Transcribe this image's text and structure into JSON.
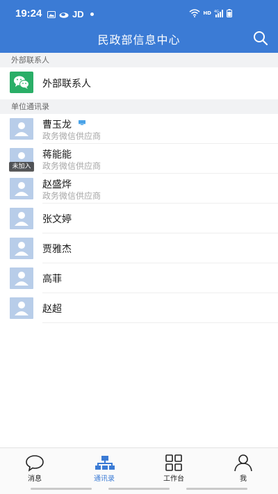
{
  "status_bar": {
    "time": "19:24",
    "jd": "JD",
    "hd": "HD",
    "net": "4G"
  },
  "header": {
    "title": "民政部信息中心"
  },
  "sections": {
    "external": "外部联系人",
    "directory": "单位通讯录"
  },
  "external_contact": {
    "label": "外部联系人"
  },
  "contacts": [
    {
      "name": "曹玉龙",
      "subtitle": "政务微信供应商"
    },
    {
      "name": "蒋能能",
      "subtitle": "政务微信供应商",
      "badge": "未加入"
    },
    {
      "name": "赵盛烨",
      "subtitle": "政务微信供应商"
    },
    {
      "name": "张文婷"
    },
    {
      "name": "贾雅杰"
    },
    {
      "name": "高菲"
    },
    {
      "name": "赵超"
    }
  ],
  "tabs": [
    {
      "label": "消息",
      "icon": "chat-bubble-icon"
    },
    {
      "label": "通讯录",
      "icon": "org-chart-icon",
      "active": true
    },
    {
      "label": "工作台",
      "icon": "grid-icon"
    },
    {
      "label": "我",
      "icon": "person-icon"
    }
  ],
  "colors": {
    "accent": "#3b7bd5",
    "wechat_green": "#2aae67",
    "avatar_bg": "#b8cde9"
  }
}
